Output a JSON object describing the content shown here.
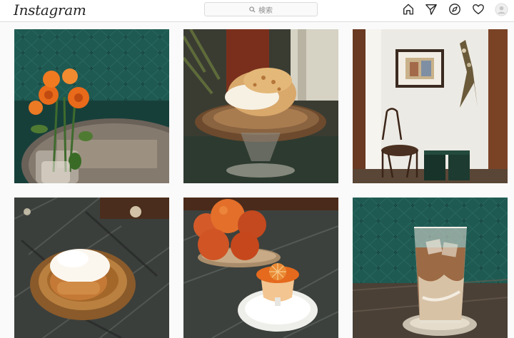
{
  "header": {
    "logo_text": "Instagram",
    "search_placeholder": "検索",
    "icons": [
      "home-icon",
      "direct-send-icon",
      "explore-compass-icon",
      "activity-heart-icon",
      "profile-avatar-icon"
    ]
  },
  "posts": [
    {
      "subject": "orange-roses-vase"
    },
    {
      "subject": "cream-puff-on-glass-stand"
    },
    {
      "subject": "corner-chair-and-framed-picture"
    },
    {
      "subject": "cream-pastry-on-amber-plate"
    },
    {
      "subject": "blood-oranges-and-jelly-dessert"
    },
    {
      "subject": "iced-cafe-au-lait"
    }
  ],
  "colors": {
    "topbar_bg": "#ffffff",
    "page_bg": "#fafafa",
    "border": "#dbdbdb",
    "text": "#262626",
    "muted": "#8e8e8e"
  }
}
